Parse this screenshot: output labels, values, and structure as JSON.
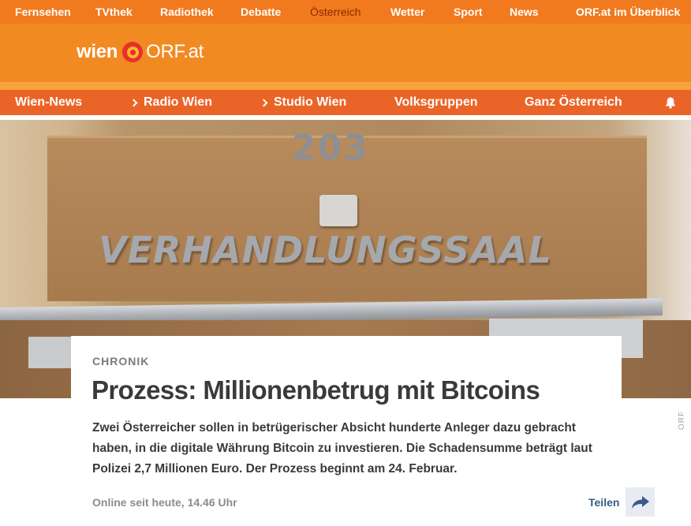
{
  "top_nav": {
    "items": [
      "Fernsehen",
      "TVthek",
      "Radiothek",
      "Debatte",
      "Österreich",
      "Wetter",
      "Sport",
      "News",
      "ORF.at im Überblick"
    ],
    "active": "Österreich"
  },
  "logo": {
    "wien": "wien",
    "orf": "ORF.at"
  },
  "sub_nav": {
    "items": [
      "Wien-News",
      "Radio Wien",
      "Studio Wien",
      "Volksgruppen",
      "Ganz Österreich"
    ],
    "bell_icon": "bell-icon"
  },
  "hero": {
    "room_number": "203",
    "sign_text": "VERHANDLUNGSSAAL",
    "credit": "ORF"
  },
  "article": {
    "category": "CHRONIK",
    "headline": "Prozess: Millionenbetrug mit Bitcoins",
    "lead": "Zwei Österreicher sollen in betrügerischer Absicht hunderte Anleger dazu gebracht haben, in die digitale Währung Bitcoin zu investieren. Die Schadensumme beträgt laut Polizei 2,7 Millionen Euro. Der Prozess beginnt am 24. Februar.",
    "meta": "Online seit heute, 14.46 Uhr"
  },
  "share": {
    "label": "Teilen",
    "icon": "share-arrow-icon"
  },
  "colors": {
    "top_nav": "#f27a1e",
    "header": "#f28a22",
    "sub_nav": "#eb6427",
    "link": "#355c8a"
  }
}
